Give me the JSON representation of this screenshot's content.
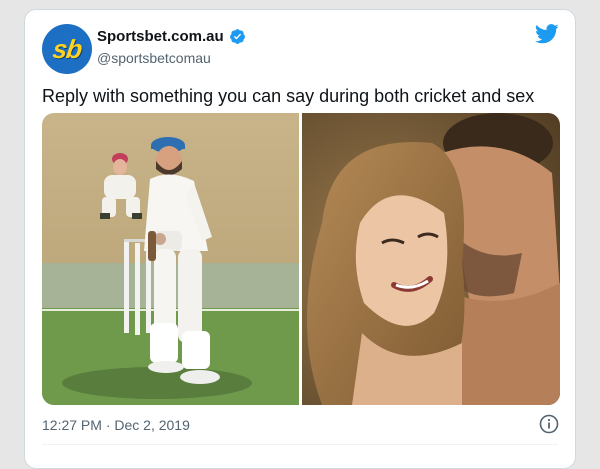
{
  "tweet": {
    "avatar_text": "sb",
    "display_name": "Sportsbet.com.au",
    "handle": "@sportsbetcomau",
    "text": "Reply with something you can say during both cricket and sex",
    "timestamp": "12:27 PM · Dec 2, 2019",
    "verified_icon": "verified-badge-icon",
    "platform_icon": "twitter-bird-icon",
    "info_icon": "info-icon"
  },
  "colors": {
    "brand_blue": "#1d9bf0",
    "avatar_bg": "#1d6fc4",
    "avatar_text": "#ffd21f",
    "text_primary": "#0f1419",
    "text_secondary": "#536471"
  }
}
